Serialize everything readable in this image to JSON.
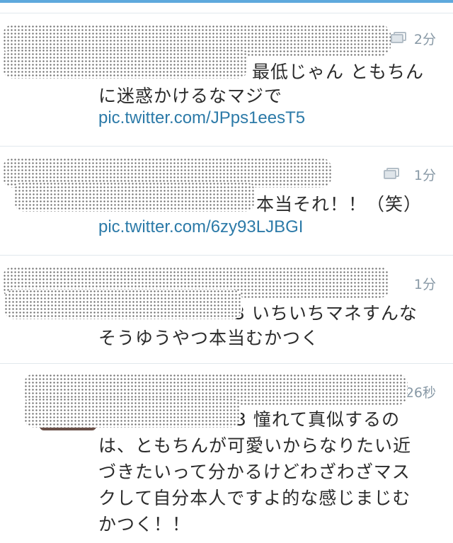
{
  "tweets": [
    {
      "time": "2分",
      "has_media": true,
      "text_lines": [
        "最低じゃん ともちん",
        "に迷惑かけるなマジで"
      ],
      "link": "pic.twitter.com/JPps1eesT5"
    },
    {
      "time": "1分",
      "has_media": true,
      "text_lines": [
        "本当それ！！（笑）"
      ],
      "link": "pic.twitter.com/6zy93LJBGI"
    },
    {
      "time": "1分",
      "has_media": false,
      "text_lines": [
        "3 いちいちマネすんな",
        "そうゆうやつ本当むかつく"
      ]
    },
    {
      "time": "26秒",
      "has_media": false,
      "text_lines": [
        "3 憧れて真似するの",
        "は、ともちんが可愛いからなりたい近",
        "づきたいって分かるけどわざわざマス",
        "クして自分本人ですよ的な感じまじむ",
        "かつく！！"
      ]
    }
  ],
  "colors": {
    "link": "#2c7aa8",
    "text": "#2b2b2b",
    "meta": "#8899a6",
    "divider": "#e1e8ed",
    "top_bar": "#5ea9dd"
  }
}
